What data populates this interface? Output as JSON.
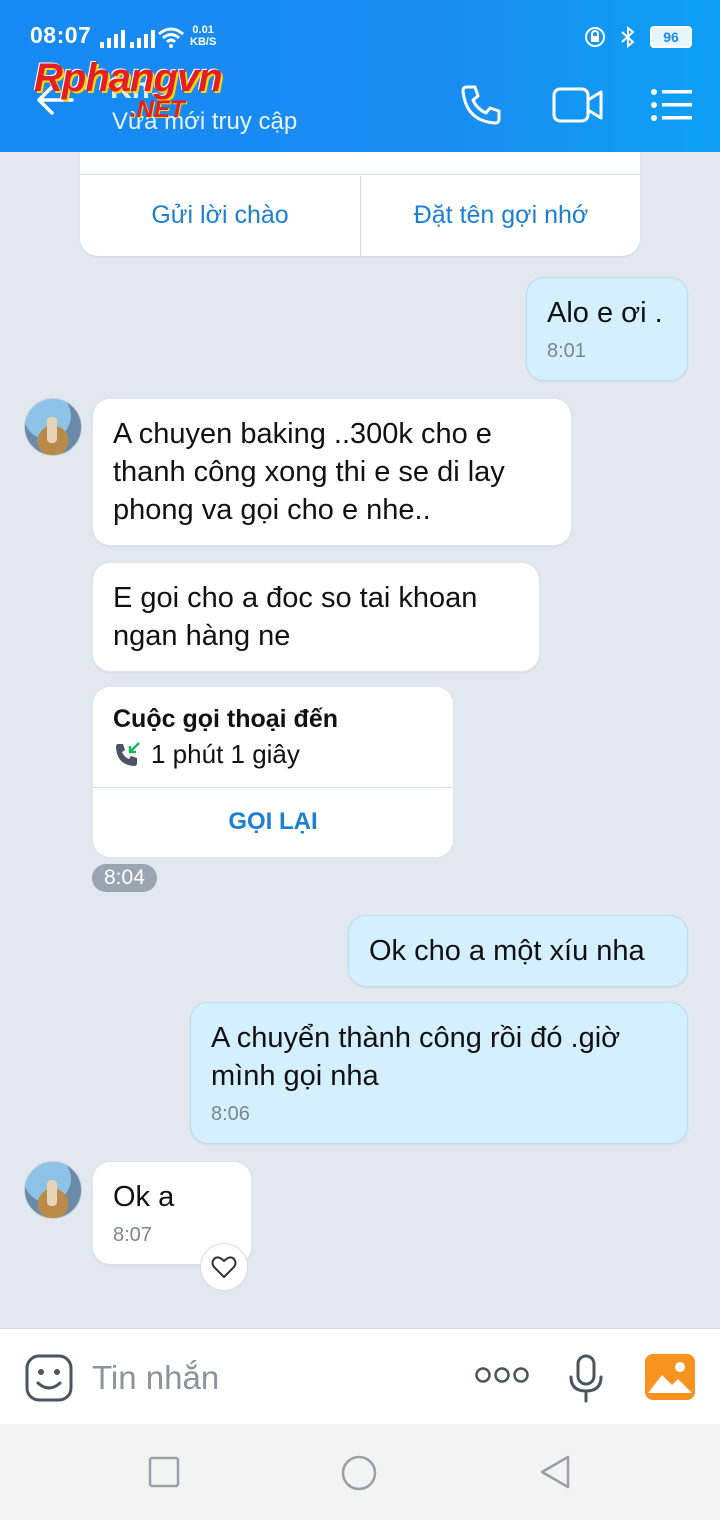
{
  "status_bar": {
    "time": "08:07",
    "net_speed_value": "0.01",
    "net_speed_unit": "KB/S",
    "battery": "96"
  },
  "header": {
    "contact_name": "Kn",
    "contact_status": "Vừa mới truy cập",
    "watermark_main": "Rphangvn",
    "watermark_sub": ".NET"
  },
  "intro_card": {
    "greet_label": "Gửi lời chào",
    "nickname_label": "Đặt tên gợi nhớ"
  },
  "messages": [
    {
      "side": "mine",
      "text": "Alo e ơi .",
      "time": "8:01"
    },
    {
      "side": "theirs",
      "text": "A chuyen baking ..300k cho e thanh công xong thi e se di lay phong va gọi cho e nhe.."
    },
    {
      "side": "theirs",
      "text": "E goi cho a đoc so tai khoan ngan hàng ne"
    },
    {
      "side": "mine",
      "text": "Ok cho a một xíu nha"
    },
    {
      "side": "mine",
      "text": "A chuyển thành công rồi đó .giờ mình gọi nha",
      "time": "8:06"
    },
    {
      "side": "theirs",
      "text": "Ok a",
      "time": "8:07"
    }
  ],
  "call_card": {
    "title": "Cuộc gọi thoại đến",
    "duration": "1 phút 1 giây",
    "callback_label": "GỌI LẠI",
    "time": "8:04"
  },
  "input_bar": {
    "placeholder": "Tin nhắn"
  },
  "colors": {
    "header_blue": "#1a8cf2",
    "my_bubble": "#d4efff",
    "chat_bg": "#e2e8f0",
    "link_blue": "#1b7fd6"
  }
}
